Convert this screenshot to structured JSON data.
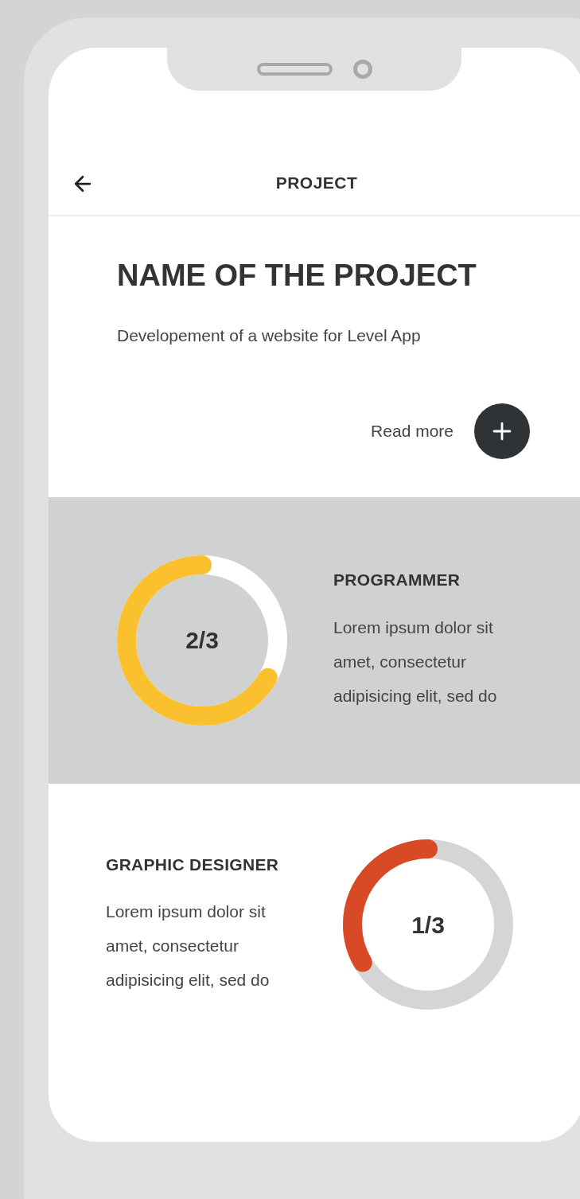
{
  "header": {
    "title": "PROJECT"
  },
  "project": {
    "title": "NAME OF THE PROJECT",
    "description": "Developement of a website for Level App",
    "read_more": "Read more"
  },
  "roles": [
    {
      "kind": "highlighted",
      "title": "PROGRAMMER",
      "text": "Lorem ipsum dolor sit amet, consectetur adipisicing elit, sed do",
      "count": "2/3",
      "level": 0.667,
      "color": "#fbc02d"
    },
    {
      "kind": "plain",
      "title": "GRAPHIC DESIGNER",
      "text": "Lorem ipsum dolor sit amet, consectetur adipisicing elit, sed do",
      "count": "1/3",
      "level": 0.333,
      "color": "#d84a26"
    }
  ]
}
